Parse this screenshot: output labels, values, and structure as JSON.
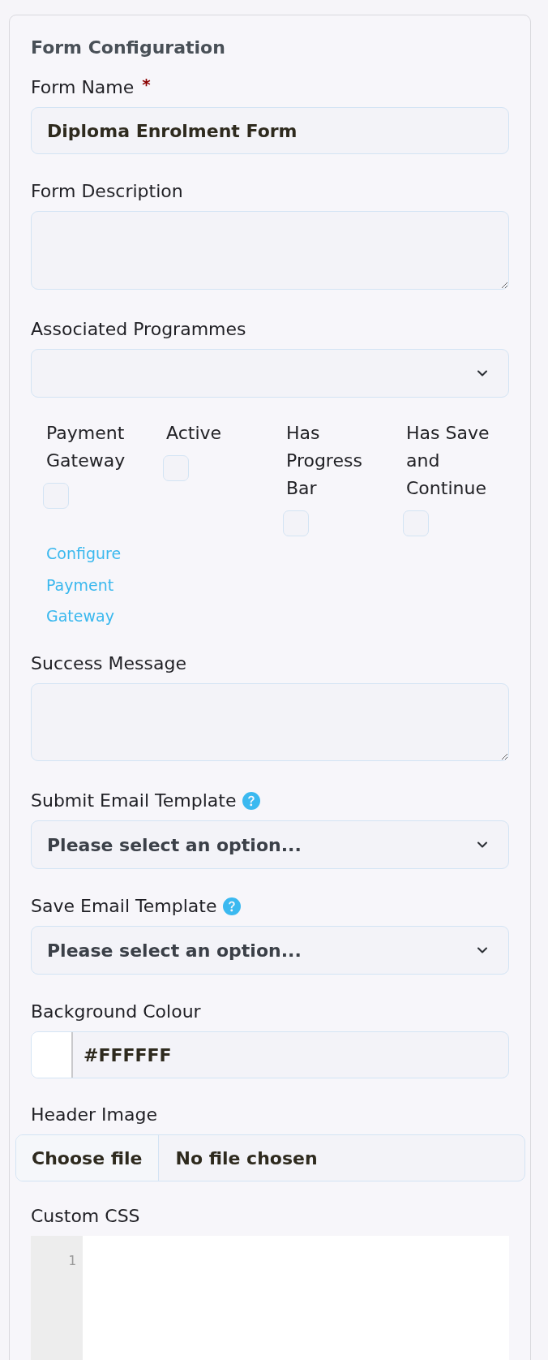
{
  "panel": {
    "title": "Form Configuration"
  },
  "fields": [
    {
      "kind": "text",
      "label": "Form Name",
      "required_mark": "*",
      "value": "Diploma Enrolment Form"
    },
    {
      "kind": "textarea",
      "label": "Form Description"
    },
    {
      "kind": "select",
      "label": "Associated Programmes"
    },
    {
      "kind": "checkbox_group",
      "options": [
        {
          "label": "Payment Gateway",
          "checked": false
        },
        {
          "label": "Active",
          "checked": false
        },
        {
          "label": "Has Progress Bar",
          "checked": false
        },
        {
          "label": "Has Save and Continue",
          "checked": false
        }
      ]
    },
    {
      "kind": "link",
      "text": "Configure Payment Gateway"
    },
    {
      "kind": "textarea",
      "label": "Success Message"
    },
    {
      "kind": "select",
      "label": "Submit Email Template",
      "help": true,
      "placeholder": "Please select an option..."
    },
    {
      "kind": "select",
      "label": "Save Email Template",
      "help": true,
      "placeholder": "Please select an option..."
    },
    {
      "kind": "color",
      "label": "Background Colour",
      "value": "#FFFFFF"
    },
    {
      "kind": "file",
      "label": "Header Image",
      "button": "Choose file",
      "status": "No file chosen"
    },
    {
      "kind": "code",
      "label": "Custom CSS",
      "line_numbers": [
        "1"
      ]
    }
  ]
}
